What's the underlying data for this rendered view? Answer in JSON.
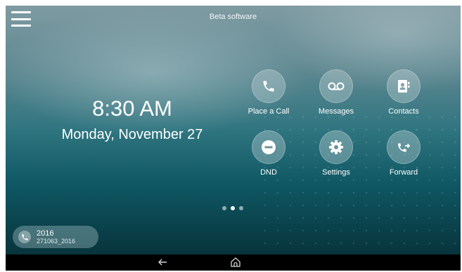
{
  "status": {
    "banner": "Beta software"
  },
  "clock": {
    "time": "8:30 AM",
    "date": "Monday, November 27"
  },
  "apps": [
    {
      "label": "Place a Call",
      "icon": "phone-icon"
    },
    {
      "label": "Messages",
      "icon": "voicemail-icon"
    },
    {
      "label": "Contacts",
      "icon": "contacts-icon"
    },
    {
      "label": "DND",
      "icon": "minus-circle-icon"
    },
    {
      "label": "Settings",
      "icon": "gear-icon"
    },
    {
      "label": "Forward",
      "icon": "call-forward-icon"
    }
  ],
  "pager": {
    "pages": 3,
    "active": 2
  },
  "line": {
    "number": "2016",
    "label": "271063_2016"
  },
  "colors": {
    "accent": "#0e5763",
    "icon_circle": "#cddcdf",
    "text": "#ffffff",
    "navbar": "#000000"
  },
  "nav": {
    "back_icon": "back-arrow-icon",
    "home_icon": "home-icon"
  }
}
